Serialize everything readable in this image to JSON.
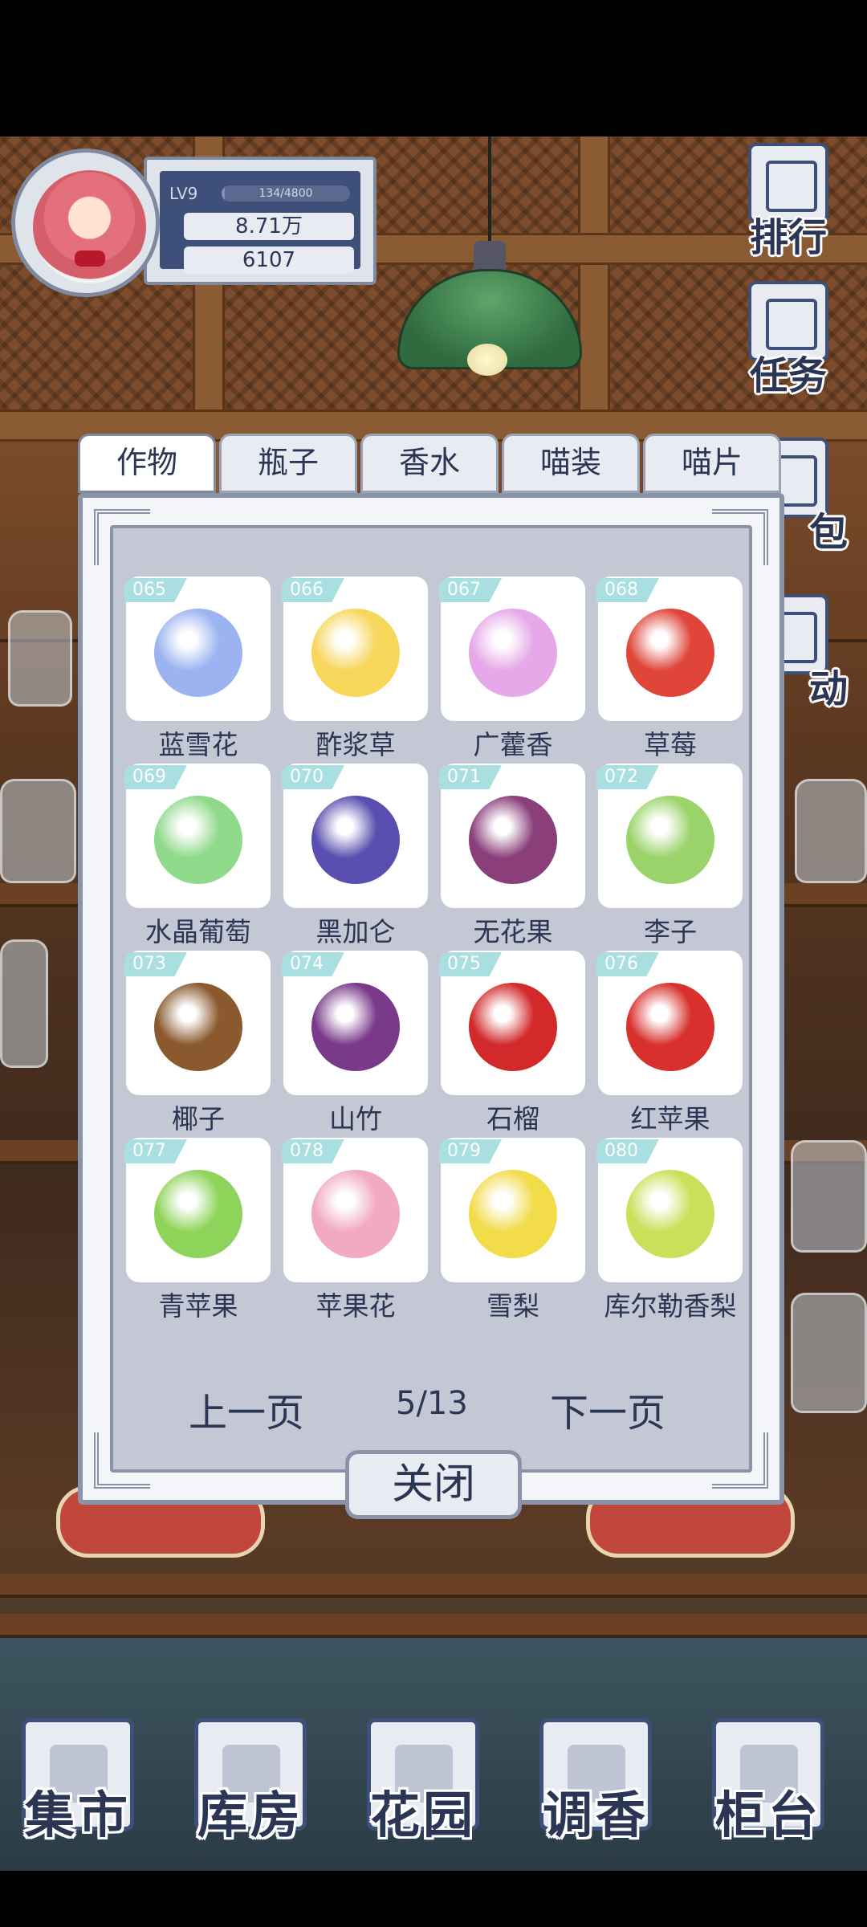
{
  "player": {
    "level": "LV9",
    "exp_text": "134/4800",
    "exp_progress": 0.028,
    "currency_primary": "8.71万",
    "currency_secondary": "6107"
  },
  "side_menu": [
    {
      "label": "排行",
      "icon": "trophy-icon"
    },
    {
      "label": "任务",
      "icon": "clipboard-icon"
    },
    {
      "label": "包",
      "icon": "bag-icon"
    },
    {
      "label": "动",
      "icon": "event-icon"
    }
  ],
  "tabs": [
    {
      "label": "作物",
      "active": true
    },
    {
      "label": "瓶子",
      "active": false
    },
    {
      "label": "香水",
      "active": false
    },
    {
      "label": "喵装",
      "active": false
    },
    {
      "label": "喵片",
      "active": false
    }
  ],
  "items": [
    {
      "id": "065",
      "name": "蓝雪花",
      "color": "#9bb3f0"
    },
    {
      "id": "066",
      "name": "酢浆草",
      "color": "#f7d65c"
    },
    {
      "id": "067",
      "name": "广藿香",
      "color": "#e6a8e8"
    },
    {
      "id": "068",
      "name": "草莓",
      "color": "#e0453a"
    },
    {
      "id": "069",
      "name": "水晶葡萄",
      "color": "#8fd98a"
    },
    {
      "id": "070",
      "name": "黑加仑",
      "color": "#5a4fb0"
    },
    {
      "id": "071",
      "name": "无花果",
      "color": "#8a3f7a"
    },
    {
      "id": "072",
      "name": "李子",
      "color": "#9ad36a"
    },
    {
      "id": "073",
      "name": "椰子",
      "color": "#8a5a2e"
    },
    {
      "id": "074",
      "name": "山竹",
      "color": "#7a3a8a"
    },
    {
      "id": "075",
      "name": "石榴",
      "color": "#d22a2a"
    },
    {
      "id": "076",
      "name": "红苹果",
      "color": "#d8302c"
    },
    {
      "id": "077",
      "name": "青苹果",
      "color": "#8fd45a"
    },
    {
      "id": "078",
      "name": "苹果花",
      "color": "#f2a9c4"
    },
    {
      "id": "079",
      "name": "雪梨",
      "color": "#f2dc4a"
    },
    {
      "id": "080",
      "name": "库尔勒香梨",
      "color": "#c9e05a"
    }
  ],
  "pagination": {
    "prev_label": "上一页",
    "page_text": "5/13",
    "next_label": "下一页"
  },
  "close_label": "关闭",
  "bottom_nav": [
    {
      "label": "集市",
      "icon": "market-icon"
    },
    {
      "label": "库房",
      "icon": "warehouse-icon"
    },
    {
      "label": "花园",
      "icon": "garden-icon"
    },
    {
      "label": "调香",
      "icon": "perfume-mixing-icon"
    },
    {
      "label": "柜台",
      "icon": "counter-icon"
    }
  ]
}
